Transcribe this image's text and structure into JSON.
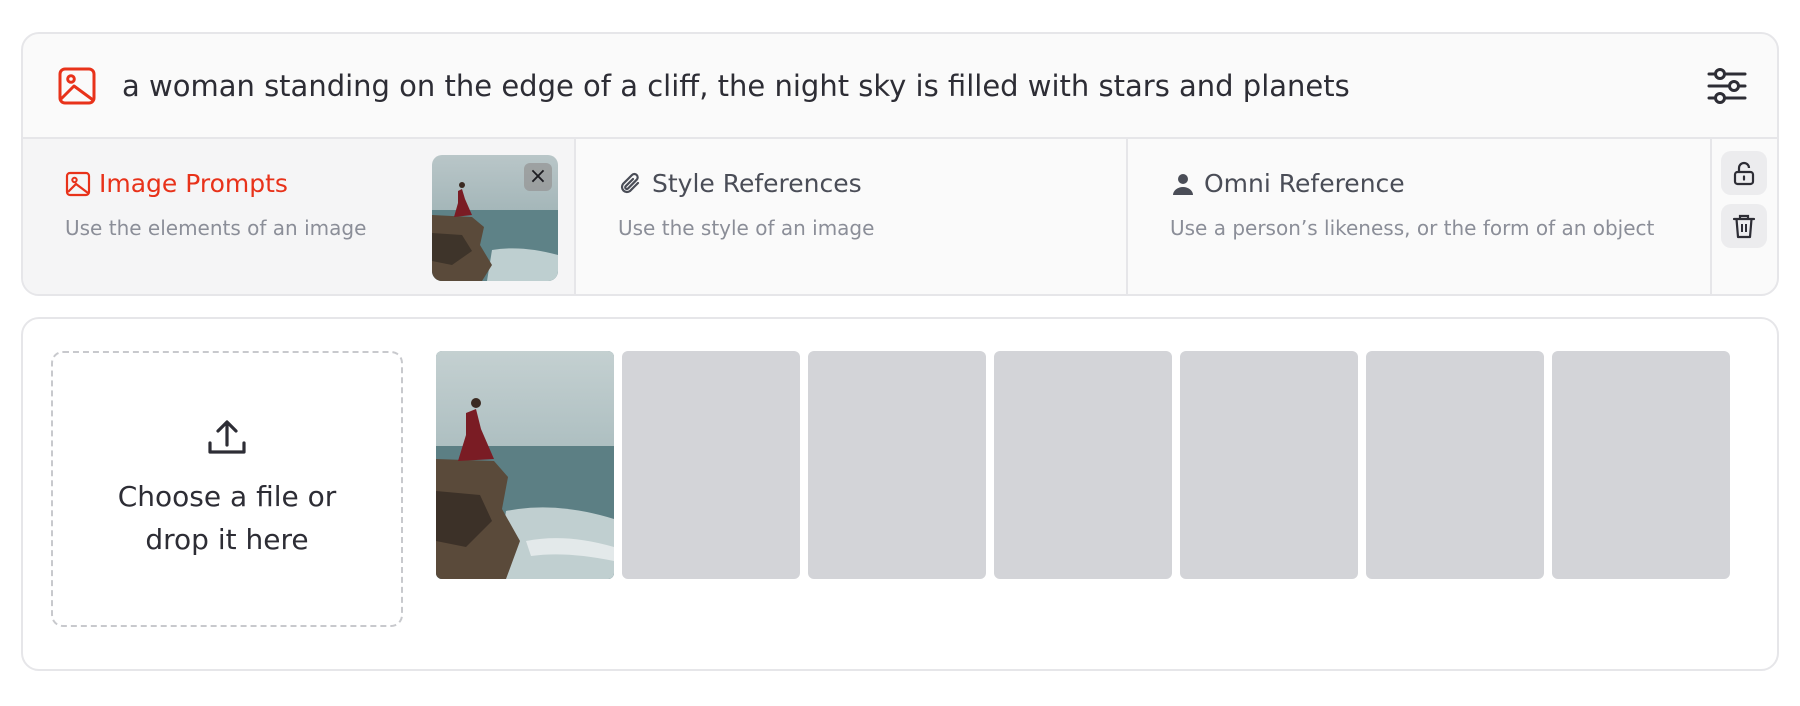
{
  "prompt": {
    "text": "a woman standing on the edge of a cliff, the night sky is filled with stars and planets",
    "icon": "image-icon",
    "settings_icon": "sliders-icon"
  },
  "reference_tabs": [
    {
      "title": "Image Prompts",
      "description": "Use the elements of an image",
      "icon": "image-icon",
      "active": true
    },
    {
      "title": "Style References",
      "description": "Use the style of an image",
      "icon": "paperclip-icon",
      "active": false
    },
    {
      "title": "Omni Reference",
      "description": "Use a person’s likeness, or the form of an object",
      "icon": "person-icon",
      "active": false
    }
  ],
  "side_actions": {
    "lock_icon": "unlock-icon",
    "delete_icon": "trash-icon"
  },
  "upload": {
    "dropzone_text": "Choose a file or drop it here",
    "icon": "upload-icon"
  },
  "gallery": {
    "filled_slots": 1,
    "total_slots": 7
  },
  "colors": {
    "accent": "#e8321a",
    "text": "#2d2d35",
    "muted": "#8b8e98",
    "border": "#e6e6e9",
    "placeholder": "#d3d4d8"
  }
}
